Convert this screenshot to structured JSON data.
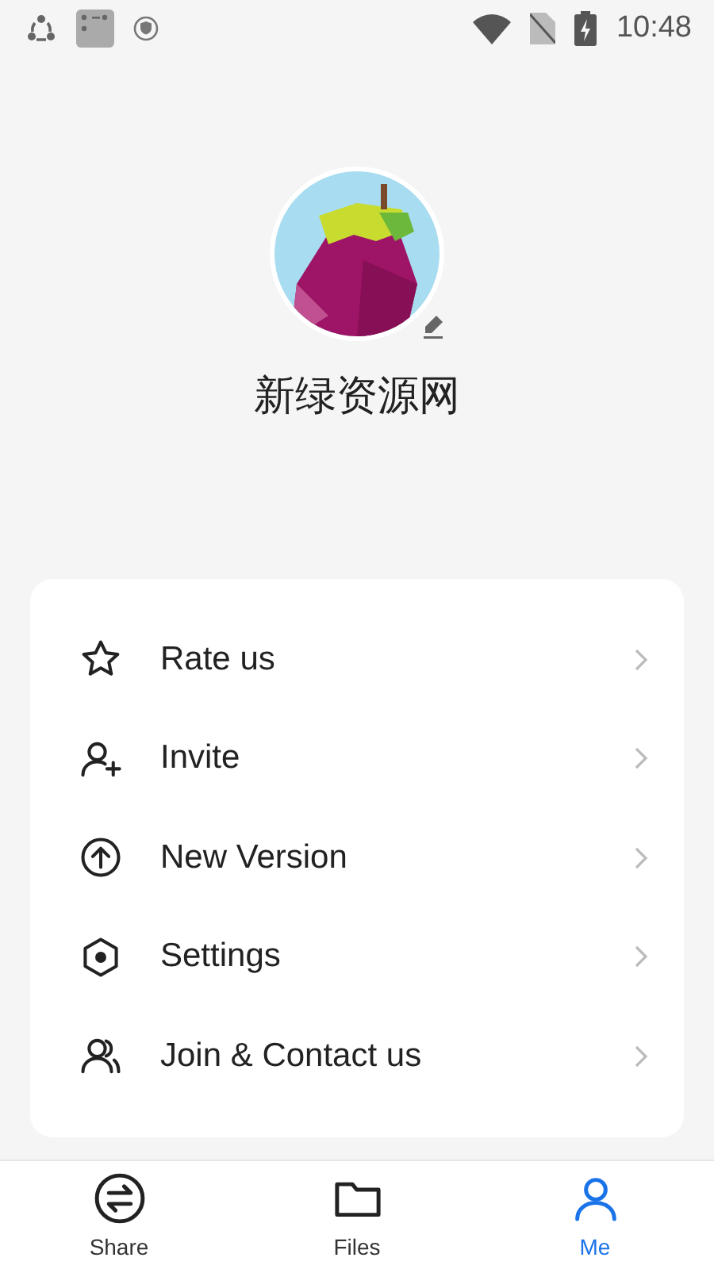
{
  "status_bar": {
    "time": "10:48"
  },
  "profile": {
    "name": "新绿资源网"
  },
  "menu": [
    {
      "kind": "star",
      "label": "Rate us"
    },
    {
      "kind": "invite",
      "label": "Invite"
    },
    {
      "kind": "update",
      "label": "New Version"
    },
    {
      "kind": "settings",
      "label": "Settings"
    },
    {
      "kind": "contact",
      "label": "Join & Contact us"
    }
  ],
  "tabs": [
    {
      "kind": "share",
      "label": "Share",
      "selected": false
    },
    {
      "kind": "files",
      "label": "Files",
      "selected": false
    },
    {
      "kind": "me",
      "label": "Me",
      "selected": true
    }
  ]
}
